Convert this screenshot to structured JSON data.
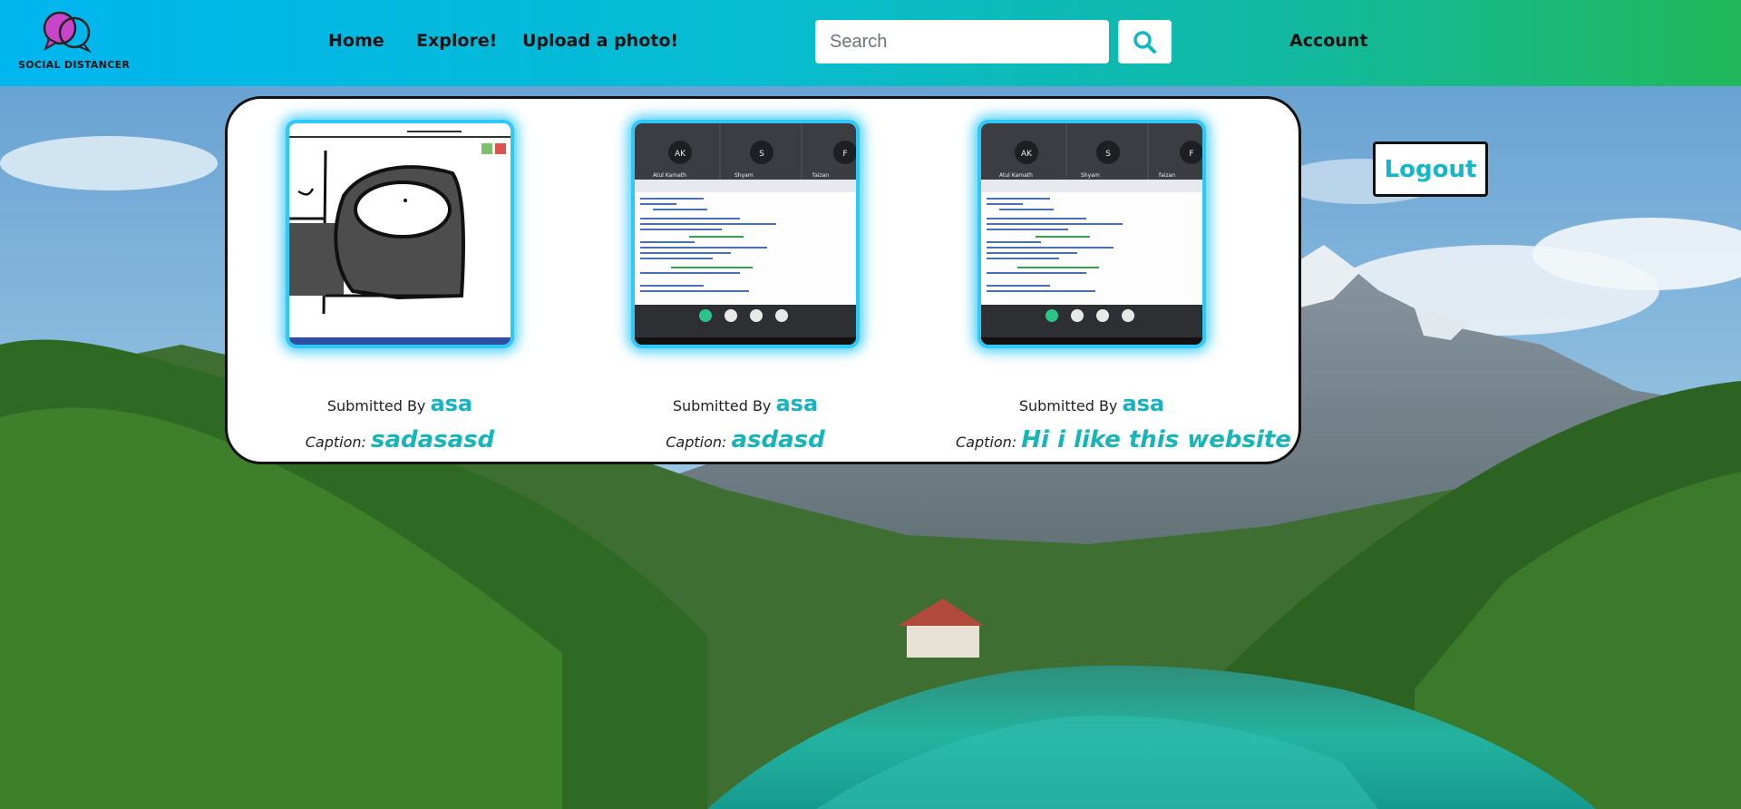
{
  "nav": {
    "brand": "SOCIAL DISTANCER",
    "links": [
      "Home",
      "Explore!",
      "Upload a photo!"
    ],
    "account_label": "Account",
    "search": {
      "placeholder": "Search",
      "value": ""
    }
  },
  "logout_label": "Logout",
  "posts": [
    {
      "submitted_label": "Submitted By",
      "user": "asa",
      "caption_label": "Caption:",
      "caption": "sadasasd"
    },
    {
      "submitted_label": "Submitted By",
      "user": "asa",
      "caption_label": "Caption:",
      "caption": "asdasd",
      "meeting_participants": [
        {
          "initials": "AK",
          "name": "Atul Kamath"
        },
        {
          "initials": "S",
          "name": "Shyam"
        },
        {
          "initials": "F",
          "name": "faizan"
        }
      ]
    },
    {
      "submitted_label": "Submitted By",
      "user": "asa",
      "caption_label": "Caption:",
      "caption": "Hi i like this website",
      "meeting_participants": [
        {
          "initials": "AK",
          "name": "Atul Kamath"
        },
        {
          "initials": "S",
          "name": "Shyam"
        },
        {
          "initials": "F",
          "name": "faizan"
        }
      ]
    }
  ],
  "colors": {
    "nav_gradient_start": "#00b6ef",
    "nav_gradient_end": "#20b85a",
    "accent_text": "#15b3c4",
    "thumb_glow": "#30c9f7"
  }
}
